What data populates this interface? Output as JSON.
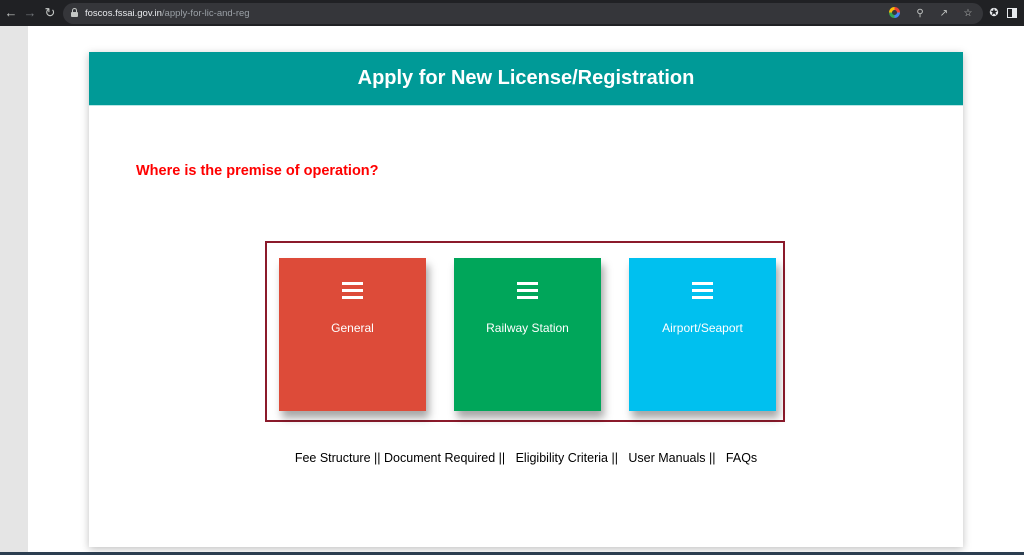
{
  "browser": {
    "url_host": "foscos.fssai.gov.in",
    "url_path": "/apply-for-lic-and-reg",
    "nav_icons": [
      "back-arrow-icon",
      "forward-arrow-icon",
      "reload-icon"
    ],
    "toolbar_icons": [
      "google-icon",
      "zoom-icon",
      "share-icon",
      "bookmark-star-icon",
      "extensions-icon",
      "side-panel-icon"
    ]
  },
  "card": {
    "title": "Apply for New License/Registration",
    "question": "Where is the premise of operation?",
    "options": [
      {
        "label": "General",
        "icon": "menu-icon",
        "color": "#dd4b39"
      },
      {
        "label": "Railway Station",
        "icon": "menu-icon",
        "color": "#00a65a"
      },
      {
        "label": "Airport/Seaport",
        "icon": "menu-icon",
        "color": "#00c0ef"
      }
    ],
    "links": [
      {
        "label": "Fee Structure"
      },
      {
        "label": "Document Required"
      },
      {
        "label": "Eligibility Criteria"
      },
      {
        "label": "User Manuals"
      },
      {
        "label": "FAQs"
      }
    ],
    "separator": "||"
  },
  "colors": {
    "header": "#009a97",
    "question": "#ff0000",
    "box_border": "#8b1a2b"
  }
}
